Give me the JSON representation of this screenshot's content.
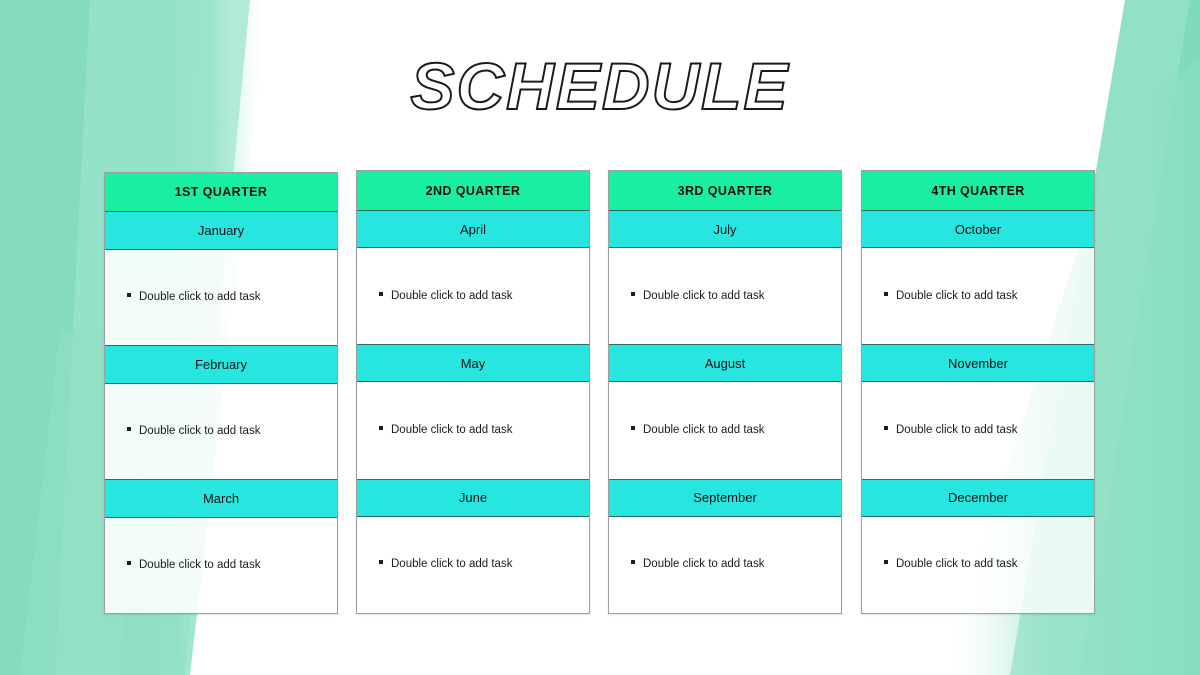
{
  "page": {
    "title": "SCHEDULE",
    "background_color": "#ffffff",
    "accent_green": "#19EFA1",
    "accent_cyan": "#27E6E0",
    "decor_green": "#8ADFC2",
    "decor_green_light": "#A6E8D1",
    "text_color": "#111111"
  },
  "quarters": [
    {
      "label": "1ST QUARTER",
      "months": [
        {
          "name": "January",
          "task": "Double click to add task"
        },
        {
          "name": "February",
          "task": "Double click to add task"
        },
        {
          "name": "March",
          "task": "Double click to add task"
        }
      ]
    },
    {
      "label": "2ND QUARTER",
      "months": [
        {
          "name": "April",
          "task": "Double click to add task"
        },
        {
          "name": "May",
          "task": "Double click to add task"
        },
        {
          "name": "June",
          "task": "Double click to add task"
        }
      ]
    },
    {
      "label": "3RD QUARTER",
      "months": [
        {
          "name": "July",
          "task": "Double click to add task"
        },
        {
          "name": "August",
          "task": "Double click to add task"
        },
        {
          "name": "September",
          "task": "Double click to add task"
        }
      ]
    },
    {
      "label": "4TH QUARTER",
      "months": [
        {
          "name": "October",
          "task": "Double click to add task"
        },
        {
          "name": "November",
          "task": "Double click to add task"
        },
        {
          "name": "December",
          "task": "Double click to add task"
        }
      ]
    }
  ]
}
